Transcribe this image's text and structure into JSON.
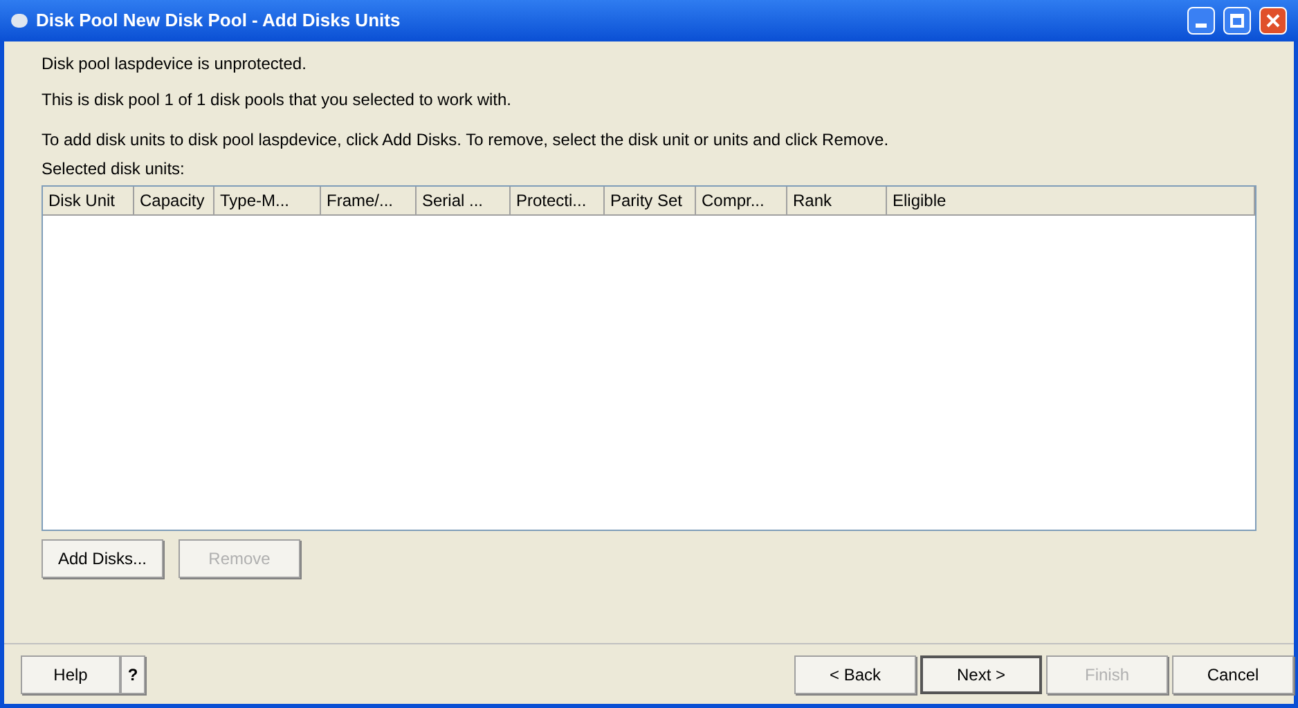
{
  "window": {
    "title": "Disk Pool New Disk Pool - Add Disks Units"
  },
  "messages": [
    "Disk pool laspdevice is unprotected.",
    "This is disk pool 1 of 1 disk pools that you selected to work with."
  ],
  "instruction": "To add disk units to disk pool laspdevice, click Add Disks. To remove, select the disk unit or units and click Remove.",
  "table": {
    "label": "Selected disk units:",
    "columns": [
      "Disk Unit",
      "Capacity",
      "Type-M...",
      "Frame/...",
      "Serial ...",
      "Protecti...",
      "Parity Set",
      "Compr...",
      "Rank",
      "Eligible"
    ]
  },
  "table_buttons": [
    {
      "label": "Add Disks...",
      "disabled": false
    },
    {
      "label": "Remove",
      "disabled": true
    }
  ],
  "help_buttons": [
    "Help",
    "?"
  ],
  "nav_buttons": [
    {
      "label": "< Back",
      "disabled": false,
      "default": false
    },
    {
      "label": "Next >",
      "disabled": false,
      "default": true
    },
    {
      "label": "Finish",
      "disabled": true,
      "default": false
    },
    {
      "label": "Cancel",
      "disabled": false,
      "default": false
    }
  ]
}
